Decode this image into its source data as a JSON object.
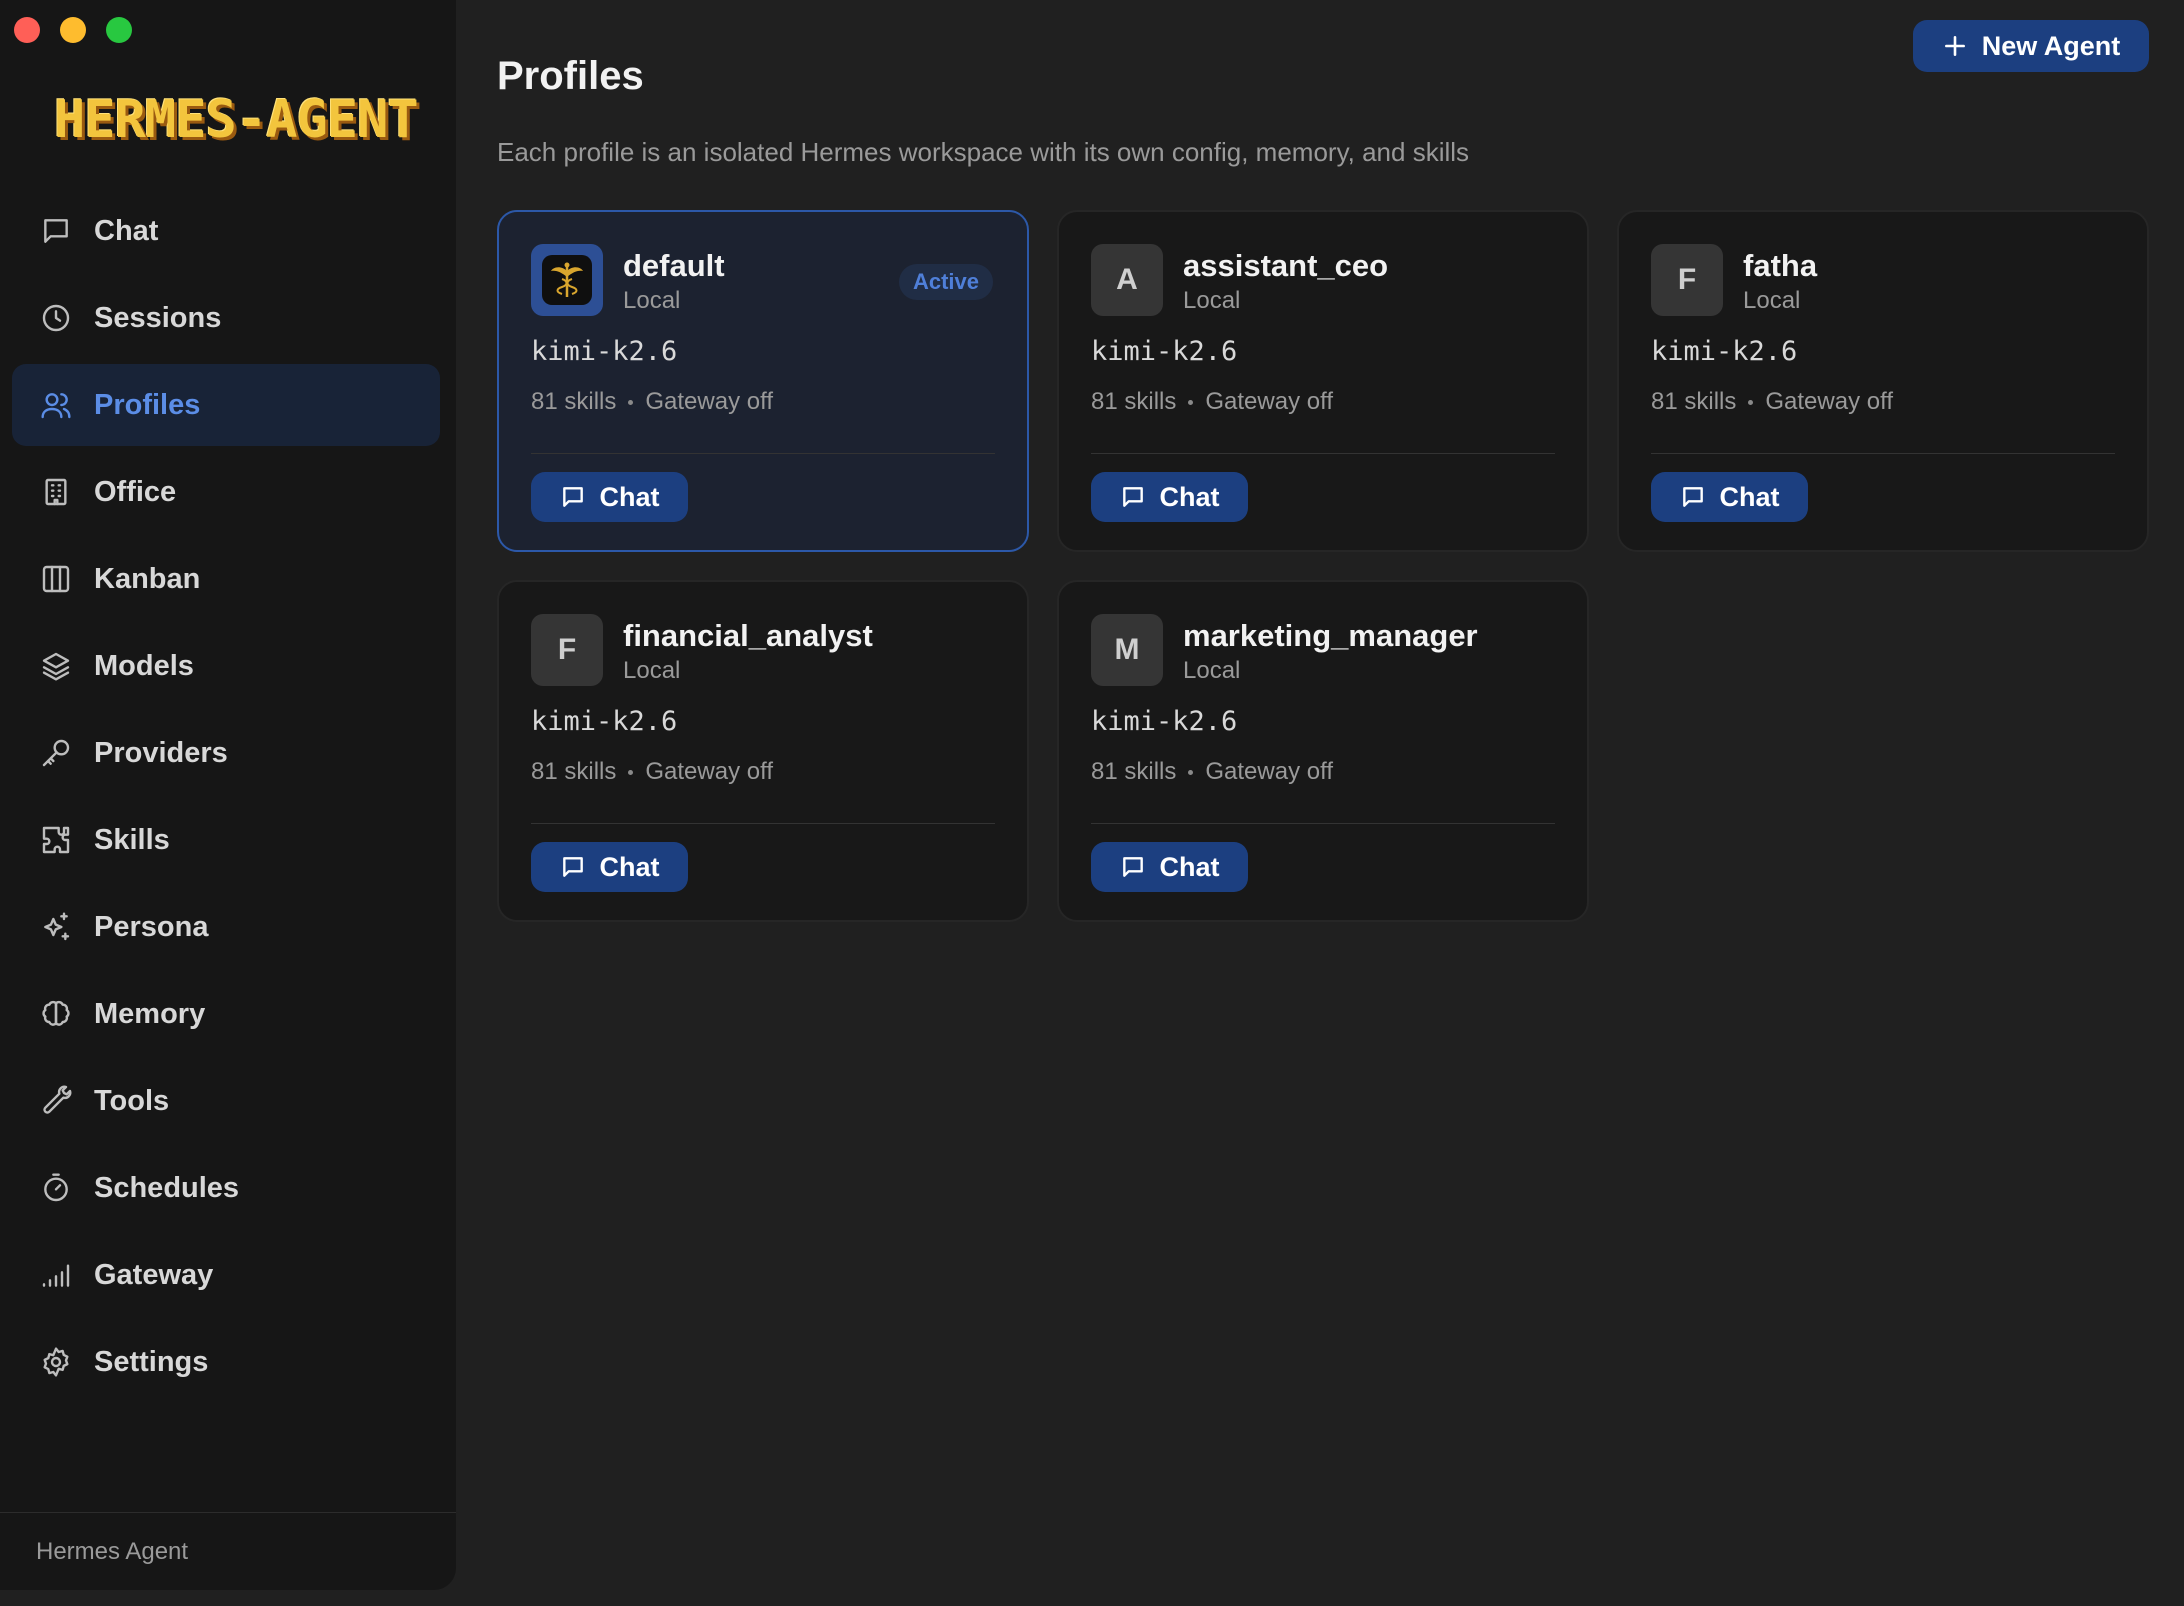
{
  "app": {
    "logo_text": "HERMES-AGENT",
    "footer_label": "Hermes Agent"
  },
  "sidebar": {
    "items": [
      {
        "label": "Chat",
        "icon": "chat-icon"
      },
      {
        "label": "Sessions",
        "icon": "clock-icon"
      },
      {
        "label": "Profiles",
        "icon": "users-icon",
        "active": true
      },
      {
        "label": "Office",
        "icon": "building-icon"
      },
      {
        "label": "Kanban",
        "icon": "columns-icon"
      },
      {
        "label": "Models",
        "icon": "layers-icon"
      },
      {
        "label": "Providers",
        "icon": "key-icon"
      },
      {
        "label": "Skills",
        "icon": "puzzle-icon"
      },
      {
        "label": "Persona",
        "icon": "sparkles-icon"
      },
      {
        "label": "Memory",
        "icon": "brain-icon"
      },
      {
        "label": "Tools",
        "icon": "wrench-icon"
      },
      {
        "label": "Schedules",
        "icon": "timer-icon"
      },
      {
        "label": "Gateway",
        "icon": "signal-icon"
      },
      {
        "label": "Settings",
        "icon": "gear-icon"
      }
    ]
  },
  "header": {
    "title": "Profiles",
    "subtitle": "Each profile is an isolated Hermes workspace with its own config, memory, and skills",
    "new_agent_label": "New Agent"
  },
  "profiles": [
    {
      "name": "default",
      "location": "Local",
      "avatar": "",
      "model": "kimi-k2.6",
      "skills": "81 skills",
      "gateway": "Gateway off",
      "badge": "Active",
      "chat_label": "Chat"
    },
    {
      "name": "assistant_ceo",
      "location": "Local",
      "avatar": "A",
      "model": "kimi-k2.6",
      "skills": "81 skills",
      "gateway": "Gateway off",
      "chat_label": "Chat"
    },
    {
      "name": "fatha",
      "location": "Local",
      "avatar": "F",
      "model": "kimi-k2.6",
      "skills": "81 skills",
      "gateway": "Gateway off",
      "chat_label": "Chat"
    },
    {
      "name": "financial_analyst",
      "location": "Local",
      "avatar": "F",
      "model": "kimi-k2.6",
      "skills": "81 skills",
      "gateway": "Gateway off",
      "chat_label": "Chat"
    },
    {
      "name": "marketing_manager",
      "location": "Local",
      "avatar": "M",
      "model": "kimi-k2.6",
      "skills": "81 skills",
      "gateway": "Gateway off",
      "chat_label": "Chat"
    }
  ],
  "colors": {
    "accent": "#1c3f80",
    "active_text": "#5b8de6",
    "background": "#202020",
    "sidebar": "#161616"
  }
}
